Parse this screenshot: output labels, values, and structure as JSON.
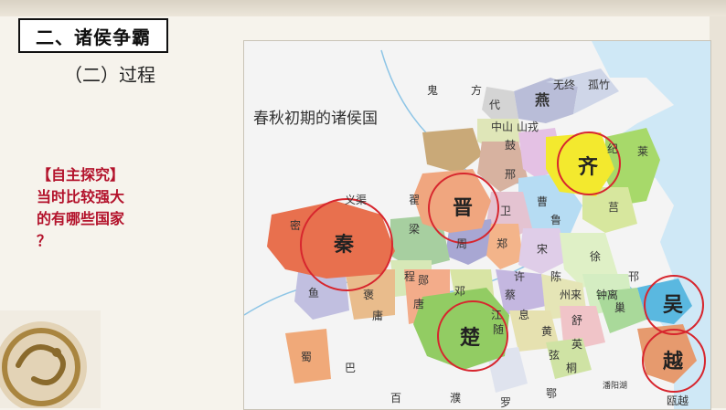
{
  "slide": {
    "heading": "二、诸侯争霸",
    "subheading": "（二）过程",
    "task_lines": [
      "【自主探究】",
      "当时比较强大",
      "的有哪些国家",
      "？"
    ]
  },
  "map": {
    "title": "春秋初期的诸侯国",
    "highlighted_states": [
      "秦",
      "晋",
      "楚",
      "齐",
      "吴",
      "越"
    ],
    "labels": [
      "鬼",
      "方",
      "无终",
      "孤竹",
      "燕",
      "代",
      "中山",
      "山戎",
      "鼓",
      "纪",
      "莱",
      "义渠",
      "翟",
      "晋",
      "卫",
      "邢",
      "曹",
      "鲁",
      "莒",
      "密",
      "秦",
      "周",
      "郑",
      "宋",
      "徐",
      "梁",
      "程",
      "许",
      "陈",
      "蔡",
      "州来",
      "钟离",
      "邗",
      "鱼",
      "褒",
      "郧",
      "庸",
      "唐",
      "息",
      "江",
      "黄",
      "舒",
      "巢",
      "吴",
      "邓",
      "随",
      "弦",
      "英",
      "桐",
      "越",
      "蜀",
      "巴",
      "楚",
      "鄂",
      "罗",
      "百",
      "濮",
      "瓯越",
      "潘阳湖"
    ]
  },
  "colors": {
    "qin": "#e8704e",
    "jin": "#f0a67f",
    "qi": "#f3e92e",
    "chu": "#92cc63",
    "wu": "#5ab8e0",
    "yue": "#e69a6e",
    "highlight_ring": "#d7262e",
    "task_text": "#b3122b"
  }
}
